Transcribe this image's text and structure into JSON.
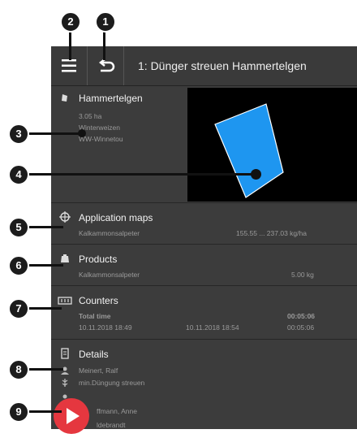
{
  "header": {
    "title": "1: Dünger streuen Hammertelgen"
  },
  "field": {
    "name": "Hammertelgen",
    "area": "3.05 ha",
    "crop": "Winterweizen",
    "owner": "WW-Winnetou",
    "polygon_color": "#1e96f0"
  },
  "application_maps": {
    "title": "Application maps",
    "product": "Kalkammonsalpeter",
    "range": "155.55 ... 237.03 kg/ha"
  },
  "products": {
    "title": "Products",
    "product": "Kalkammonsalpeter",
    "amount": "5.00 kg"
  },
  "counters": {
    "title": "Counters",
    "total_label": "Total time",
    "total_value": "00:05:06",
    "start": "10.11.2018 18:49",
    "end": "10.11.2018 18:54",
    "duration": "00:05:06"
  },
  "details": {
    "title": "Details",
    "customer": "Meinert, Ralf",
    "task": "min.Düngung streuen",
    "worker": "ffmann, Anne",
    "extra": "ldebrandt"
  },
  "callouts": [
    "1",
    "2",
    "3",
    "4",
    "5",
    "6",
    "7",
    "8",
    "9"
  ],
  "colors": {
    "accent_play": "#e5373f",
    "panel": "#3c3c3c",
    "map_bg": "#000000"
  }
}
